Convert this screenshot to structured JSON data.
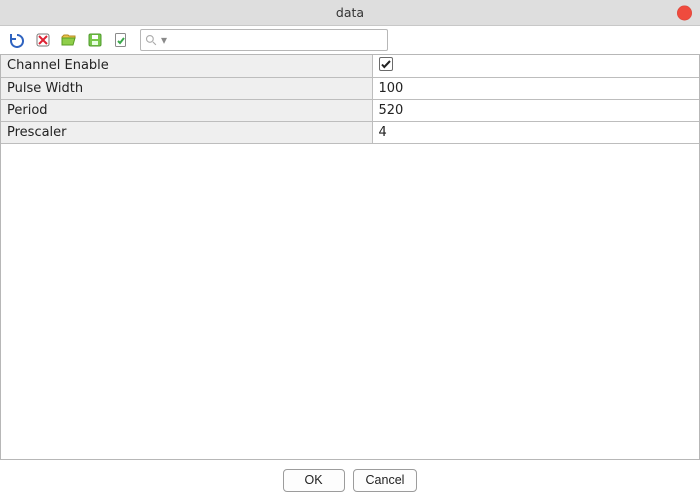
{
  "window": {
    "title": "data"
  },
  "toolbar": {
    "icons": {
      "undo": "undo-icon",
      "breakpoint": "breakpoint-remove-icon",
      "open": "open-folder-icon",
      "save": "save-icon",
      "validate": "validate-icon"
    },
    "search": {
      "placeholder": ""
    }
  },
  "properties": [
    {
      "label": "Channel Enable",
      "type": "bool",
      "value": true
    },
    {
      "label": "Pulse Width",
      "type": "int",
      "value": "100"
    },
    {
      "label": "Period",
      "type": "int",
      "value": "520"
    },
    {
      "label": "Prescaler",
      "type": "int",
      "value": "4"
    }
  ],
  "buttons": {
    "ok": "OK",
    "cancel": "Cancel"
  }
}
